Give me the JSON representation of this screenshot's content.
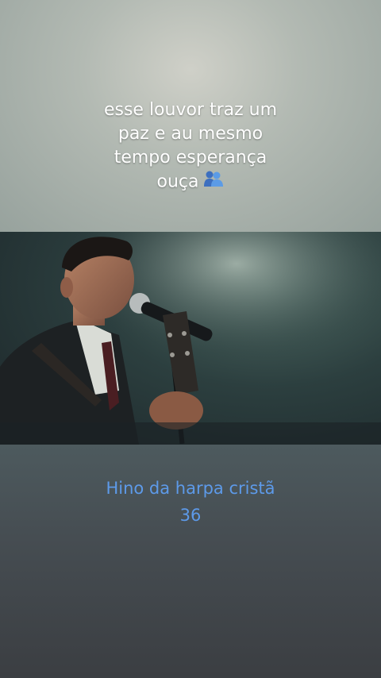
{
  "caption": {
    "line1": "esse louvor traz um",
    "line2": "paz e au mesmo",
    "line3": "tempo esperança",
    "line4": "ouça",
    "emoji_icon": "people-hugging-icon"
  },
  "video": {
    "description_icon": "singer-with-microphone-image"
  },
  "hymn": {
    "title": "Hino da harpa cristã",
    "number": "36",
    "color": "#5d9ae9"
  }
}
